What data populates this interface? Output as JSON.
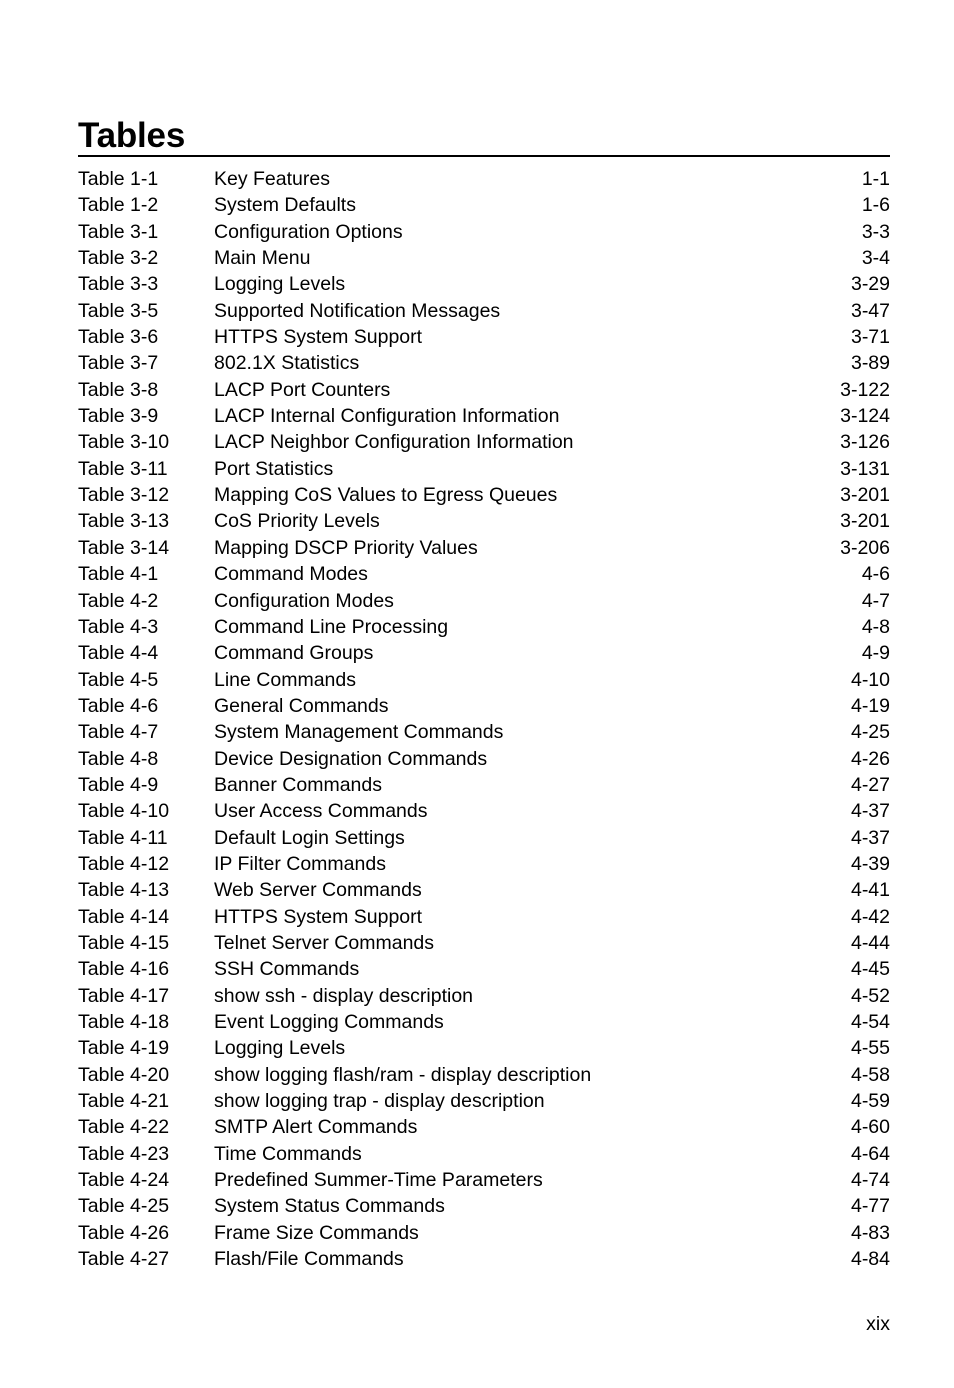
{
  "page": {
    "title": "Tables",
    "folio": "xix"
  },
  "toc": {
    "entries": [
      {
        "label": "Table 1-1",
        "text": "Key Features",
        "page": "1-1"
      },
      {
        "label": "Table 1-2",
        "text": "System Defaults",
        "page": "1-6"
      },
      {
        "label": "Table 3-1",
        "text": "Configuration Options",
        "page": "3-3"
      },
      {
        "label": "Table 3-2",
        "text": "Main Menu",
        "page": "3-4"
      },
      {
        "label": "Table 3-3",
        "text": "Logging Levels",
        "page": "3-29"
      },
      {
        "label": "Table 3-5",
        "text": "Supported Notification Messages",
        "page": "3-47"
      },
      {
        "label": "Table 3-6",
        "text": "HTTPS System Support",
        "page": "3-71"
      },
      {
        "label": "Table 3-7",
        "text": "802.1X Statistics",
        "page": "3-89"
      },
      {
        "label": "Table 3-8",
        "text": "LACP Port Counters",
        "page": "3-122"
      },
      {
        "label": "Table 3-9",
        "text": "LACP Internal Configuration Information",
        "page": "3-124"
      },
      {
        "label": "Table 3-10",
        "text": "LACP Neighbor Configuration Information",
        "page": "3-126"
      },
      {
        "label": "Table 3-11",
        "text": "Port Statistics",
        "page": "3-131"
      },
      {
        "label": "Table 3-12",
        "text": "Mapping CoS Values to Egress Queues",
        "page": "3-201"
      },
      {
        "label": "Table 3-13",
        "text": "CoS Priority Levels",
        "page": "3-201"
      },
      {
        "label": "Table 3-14",
        "text": "Mapping DSCP Priority Values",
        "page": "3-206"
      },
      {
        "label": "Table 4-1",
        "text": "Command Modes",
        "page": "4-6"
      },
      {
        "label": "Table 4-2",
        "text": "Configuration Modes",
        "page": "4-7"
      },
      {
        "label": "Table 4-3",
        "text": "Command Line Processing",
        "page": "4-8"
      },
      {
        "label": "Table 4-4",
        "text": "Command Groups",
        "page": "4-9"
      },
      {
        "label": "Table 4-5",
        "text": "Line Commands",
        "page": "4-10"
      },
      {
        "label": "Table 4-6",
        "text": "General Commands",
        "page": "4-19"
      },
      {
        "label": "Table 4-7",
        "text": "System Management Commands",
        "page": "4-25"
      },
      {
        "label": "Table 4-8",
        "text": "Device Designation Commands",
        "page": "4-26"
      },
      {
        "label": "Table 4-9",
        "text": "Banner Commands",
        "page": "4-27"
      },
      {
        "label": "Table 4-10",
        "text": "User Access Commands",
        "page": "4-37"
      },
      {
        "label": "Table 4-11",
        "text": "Default Login Settings",
        "page": "4-37"
      },
      {
        "label": "Table 4-12",
        "text": "IP Filter Commands",
        "page": "4-39"
      },
      {
        "label": "Table 4-13",
        "text": "Web Server Commands",
        "page": "4-41"
      },
      {
        "label": "Table 4-14",
        "text": "HTTPS System Support",
        "page": "4-42"
      },
      {
        "label": "Table 4-15",
        "text": "Telnet Server Commands",
        "page": "4-44"
      },
      {
        "label": "Table 4-16",
        "text": "SSH Commands",
        "page": "4-45"
      },
      {
        "label": "Table 4-17",
        "text": "show ssh - display description",
        "page": "4-52"
      },
      {
        "label": "Table 4-18",
        "text": "Event Logging Commands",
        "page": "4-54"
      },
      {
        "label": "Table 4-19",
        "text": "Logging Levels",
        "page": "4-55"
      },
      {
        "label": "Table 4-20",
        "text": "show logging flash/ram - display description",
        "page": "4-58"
      },
      {
        "label": "Table 4-21",
        "text": "show logging trap - display description",
        "page": "4-59"
      },
      {
        "label": "Table 4-22",
        "text": "SMTP Alert Commands",
        "page": "4-60"
      },
      {
        "label": "Table 4-23",
        "text": "Time Commands",
        "page": "4-64"
      },
      {
        "label": "Table 4-24",
        "text": "Predefined Summer-Time Parameters",
        "page": "4-74"
      },
      {
        "label": "Table 4-25",
        "text": "System Status Commands",
        "page": "4-77"
      },
      {
        "label": "Table 4-26",
        "text": "Frame Size Commands",
        "page": "4-83"
      },
      {
        "label": "Table 4-27",
        "text": "Flash/File Commands",
        "page": "4-84"
      }
    ]
  }
}
